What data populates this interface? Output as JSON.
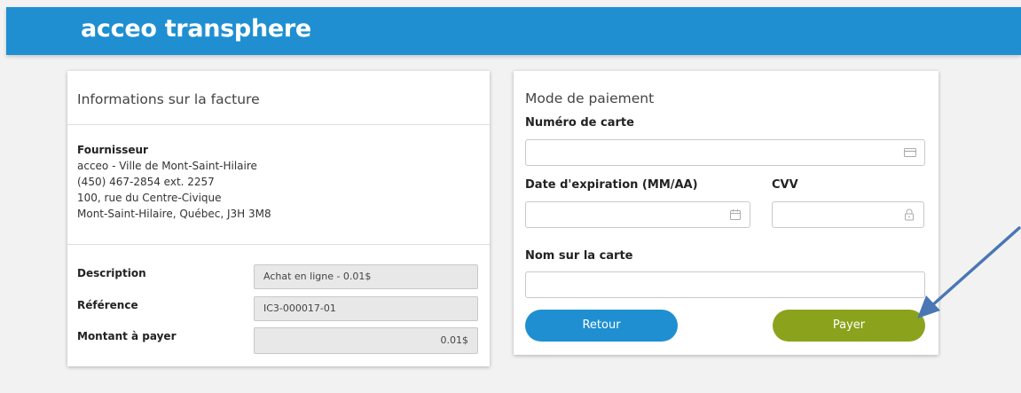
{
  "header": {
    "logo": "acceo transphere"
  },
  "invoice": {
    "title": "Informations sur la facture",
    "provider_label": "Fournisseur",
    "provider_lines": [
      "acceo - Ville de Mont-Saint-Hilaire",
      "(450) 467-2854 ext. 2257",
      "100, rue du Centre-Civique",
      "Mont-Saint-Hilaire, Québec, J3H 3M8"
    ],
    "rows": [
      {
        "label": "Description",
        "value": "Achat en ligne - 0.01$"
      },
      {
        "label": "Référence",
        "value": "IC3-000017-01"
      },
      {
        "label": "Montant à payer",
        "value": "0.01$"
      }
    ]
  },
  "payment": {
    "title": "Mode de paiement",
    "card_number_label": "Numéro de carte",
    "card_number_value": "",
    "expiry_label": "Date d'expiration (MM/AA)",
    "expiry_value": "",
    "cvv_label": "CVV",
    "cvv_value": "",
    "name_label": "Nom sur la carte",
    "name_value": "",
    "back_label": "Retour",
    "pay_label": "Payer"
  },
  "icons": {
    "card": "credit-card-icon",
    "calendar": "calendar-icon",
    "lock": "lock-icon",
    "arrow": "annotation-arrow"
  },
  "colors": {
    "header": "#1f8fd1",
    "primary_button": "#1f8fd1",
    "pay_button": "#8ba31c",
    "arrow": "#4a77b4"
  }
}
